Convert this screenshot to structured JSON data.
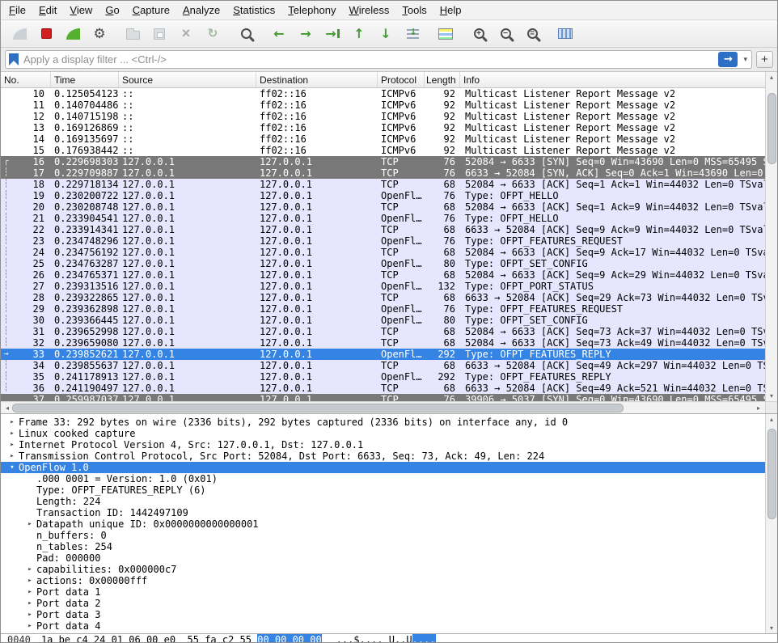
{
  "menu": {
    "items": [
      "File",
      "Edit",
      "View",
      "Go",
      "Capture",
      "Analyze",
      "Statistics",
      "Telephony",
      "Wireless",
      "Tools",
      "Help"
    ]
  },
  "toolbar": {
    "groups": [
      [
        {
          "name": "start-capture",
          "icon": "fin-start",
          "disabled": true
        },
        {
          "name": "stop-capture",
          "icon": "stop",
          "disabled": false
        },
        {
          "name": "restart-capture",
          "icon": "fin-restart",
          "disabled": false
        },
        {
          "name": "capture-options",
          "icon": "gear",
          "disabled": false
        }
      ],
      [
        {
          "name": "open-capture-file",
          "icon": "folder",
          "disabled": true
        },
        {
          "name": "save-capture-file",
          "icon": "save",
          "disabled": true
        },
        {
          "name": "close-capture-file",
          "icon": "close",
          "disabled": true
        },
        {
          "name": "reload-capture-file",
          "icon": "reload",
          "disabled": true
        }
      ],
      [
        {
          "name": "find-packet",
          "icon": "find",
          "disabled": false
        }
      ],
      [
        {
          "name": "go-back",
          "icon": "arrow-left",
          "disabled": false
        },
        {
          "name": "go-forward",
          "icon": "arrow-right",
          "disabled": false
        },
        {
          "name": "go-to-packet",
          "icon": "goto",
          "disabled": false
        },
        {
          "name": "go-first-packet",
          "icon": "arrow-up",
          "disabled": false
        },
        {
          "name": "go-last-packet",
          "icon": "arrow-down",
          "disabled": false
        },
        {
          "name": "auto-scroll",
          "icon": "autoscroll",
          "disabled": false
        }
      ],
      [
        {
          "name": "colorize-packets",
          "icon": "colorize",
          "disabled": false
        }
      ],
      [
        {
          "name": "zoom-in",
          "icon": "zoom-in",
          "disabled": false
        },
        {
          "name": "zoom-out",
          "icon": "zoom-out",
          "disabled": false
        },
        {
          "name": "zoom-normal",
          "icon": "zoom-normal",
          "disabled": false
        }
      ],
      [
        {
          "name": "resize-columns",
          "icon": "resize-columns",
          "disabled": false
        }
      ]
    ]
  },
  "filter": {
    "placeholder": "Apply a display filter ... <Ctrl-/>",
    "add_button": "+"
  },
  "packet_list": {
    "columns": [
      "No.",
      "Time",
      "Source",
      "Destination",
      "Protocol",
      "Length",
      "Info"
    ],
    "rows": [
      {
        "no": "10",
        "time": "0.125054123",
        "src": "::",
        "dst": "ff02::16",
        "proto": "ICMPv6",
        "len": "92",
        "info": "Multicast Listener Report Message v2",
        "style": "white",
        "mark": ""
      },
      {
        "no": "11",
        "time": "0.140704486",
        "src": "::",
        "dst": "ff02::16",
        "proto": "ICMPv6",
        "len": "92",
        "info": "Multicast Listener Report Message v2",
        "style": "white",
        "mark": ""
      },
      {
        "no": "12",
        "time": "0.140715198",
        "src": "::",
        "dst": "ff02::16",
        "proto": "ICMPv6",
        "len": "92",
        "info": "Multicast Listener Report Message v2",
        "style": "white",
        "mark": ""
      },
      {
        "no": "13",
        "time": "0.169126869",
        "src": "::",
        "dst": "ff02::16",
        "proto": "ICMPv6",
        "len": "92",
        "info": "Multicast Listener Report Message v2",
        "style": "white",
        "mark": ""
      },
      {
        "no": "14",
        "time": "0.169135697",
        "src": "::",
        "dst": "ff02::16",
        "proto": "ICMPv6",
        "len": "92",
        "info": "Multicast Listener Report Message v2",
        "style": "white",
        "mark": ""
      },
      {
        "no": "15",
        "time": "0.176938442",
        "src": "::",
        "dst": "ff02::16",
        "proto": "ICMPv6",
        "len": "92",
        "info": "Multicast Listener Report Message v2",
        "style": "white",
        "mark": ""
      },
      {
        "no": "16",
        "time": "0.229698303",
        "src": "127.0.0.1",
        "dst": "127.0.0.1",
        "proto": "TCP",
        "len": "76",
        "info": "52084 → 6633 [SYN] Seq=0 Win=43690 Len=0 MSS=65495 S",
        "style": "gray",
        "mark": "┌"
      },
      {
        "no": "17",
        "time": "0.229709887",
        "src": "127.0.0.1",
        "dst": "127.0.0.1",
        "proto": "TCP",
        "len": "76",
        "info": "6633 → 52084 [SYN, ACK] Seq=0 Ack=1 Win=43690 Len=0",
        "style": "gray",
        "mark": "┆"
      },
      {
        "no": "18",
        "time": "0.229718134",
        "src": "127.0.0.1",
        "dst": "127.0.0.1",
        "proto": "TCP",
        "len": "68",
        "info": "52084 → 6633 [ACK] Seq=1 Ack=1 Win=44032 Len=0 TSval",
        "style": "tcp",
        "mark": "┆"
      },
      {
        "no": "19",
        "time": "0.230200722",
        "src": "127.0.0.1",
        "dst": "127.0.0.1",
        "proto": "OpenFl…",
        "len": "76",
        "info": "Type: OFPT_HELLO",
        "style": "tcp",
        "mark": "┆"
      },
      {
        "no": "20",
        "time": "0.230208748",
        "src": "127.0.0.1",
        "dst": "127.0.0.1",
        "proto": "TCP",
        "len": "68",
        "info": "52084 → 6633 [ACK] Seq=1 Ack=9 Win=44032 Len=0 TSval",
        "style": "tcp",
        "mark": "┆"
      },
      {
        "no": "21",
        "time": "0.233904541",
        "src": "127.0.0.1",
        "dst": "127.0.0.1",
        "proto": "OpenFl…",
        "len": "76",
        "info": "Type: OFPT_HELLO",
        "style": "tcp",
        "mark": "┆"
      },
      {
        "no": "22",
        "time": "0.233914341",
        "src": "127.0.0.1",
        "dst": "127.0.0.1",
        "proto": "TCP",
        "len": "68",
        "info": "6633 → 52084 [ACK] Seq=9 Ack=9 Win=44032 Len=0 TSval",
        "style": "tcp",
        "mark": "┆"
      },
      {
        "no": "23",
        "time": "0.234748296",
        "src": "127.0.0.1",
        "dst": "127.0.0.1",
        "proto": "OpenFl…",
        "len": "76",
        "info": "Type: OFPT_FEATURES_REQUEST",
        "style": "tcp",
        "mark": "┆"
      },
      {
        "no": "24",
        "time": "0.234756192",
        "src": "127.0.0.1",
        "dst": "127.0.0.1",
        "proto": "TCP",
        "len": "68",
        "info": "52084 → 6633 [ACK] Seq=9 Ack=17 Win=44032 Len=0 TSva",
        "style": "tcp",
        "mark": "┆"
      },
      {
        "no": "25",
        "time": "0.234763287",
        "src": "127.0.0.1",
        "dst": "127.0.0.1",
        "proto": "OpenFl…",
        "len": "80",
        "info": "Type: OFPT_SET_CONFIG",
        "style": "tcp",
        "mark": "┆"
      },
      {
        "no": "26",
        "time": "0.234765371",
        "src": "127.0.0.1",
        "dst": "127.0.0.1",
        "proto": "TCP",
        "len": "68",
        "info": "52084 → 6633 [ACK] Seq=9 Ack=29 Win=44032 Len=0 TSva",
        "style": "tcp",
        "mark": "┆"
      },
      {
        "no": "27",
        "time": "0.239313516",
        "src": "127.0.0.1",
        "dst": "127.0.0.1",
        "proto": "OpenFl…",
        "len": "132",
        "info": "Type: OFPT_PORT_STATUS",
        "style": "tcp",
        "mark": "┆"
      },
      {
        "no": "28",
        "time": "0.239322865",
        "src": "127.0.0.1",
        "dst": "127.0.0.1",
        "proto": "TCP",
        "len": "68",
        "info": "6633 → 52084 [ACK] Seq=29 Ack=73 Win=44032 Len=0 TSv",
        "style": "tcp",
        "mark": "┆"
      },
      {
        "no": "29",
        "time": "0.239362898",
        "src": "127.0.0.1",
        "dst": "127.0.0.1",
        "proto": "OpenFl…",
        "len": "76",
        "info": "Type: OFPT_FEATURES_REQUEST",
        "style": "tcp",
        "mark": "┆"
      },
      {
        "no": "30",
        "time": "0.239366445",
        "src": "127.0.0.1",
        "dst": "127.0.0.1",
        "proto": "OpenFl…",
        "len": "80",
        "info": "Type: OFPT_SET_CONFIG",
        "style": "tcp",
        "mark": "┆"
      },
      {
        "no": "31",
        "time": "0.239652998",
        "src": "127.0.0.1",
        "dst": "127.0.0.1",
        "proto": "TCP",
        "len": "68",
        "info": "52084 → 6633 [ACK] Seq=73 Ack=37 Win=44032 Len=0 TSv",
        "style": "tcp",
        "mark": "┆"
      },
      {
        "no": "32",
        "time": "0.239659080",
        "src": "127.0.0.1",
        "dst": "127.0.0.1",
        "proto": "TCP",
        "len": "68",
        "info": "52084 → 6633 [ACK] Seq=73 Ack=49 Win=44032 Len=0 TSv",
        "style": "tcp",
        "mark": "┆"
      },
      {
        "no": "33",
        "time": "0.239852621",
        "src": "127.0.0.1",
        "dst": "127.0.0.1",
        "proto": "OpenFl…",
        "len": "292",
        "info": "Type: OFPT_FEATURES_REPLY",
        "style": "selected",
        "mark": "→"
      },
      {
        "no": "34",
        "time": "0.239855637",
        "src": "127.0.0.1",
        "dst": "127.0.0.1",
        "proto": "TCP",
        "len": "68",
        "info": "6633 → 52084 [ACK] Seq=49 Ack=297 Win=44032 Len=0 TS",
        "style": "tcp",
        "mark": "┆"
      },
      {
        "no": "35",
        "time": "0.241178913",
        "src": "127.0.0.1",
        "dst": "127.0.0.1",
        "proto": "OpenFl…",
        "len": "292",
        "info": "Type: OFPT_FEATURES_REPLY",
        "style": "tcp",
        "mark": "┆"
      },
      {
        "no": "36",
        "time": "0.241190497",
        "src": "127.0.0.1",
        "dst": "127.0.0.1",
        "proto": "TCP",
        "len": "68",
        "info": "6633 → 52084 [ACK] Seq=49 Ack=521 Win=44032 Len=0 TS",
        "style": "tcp",
        "mark": "┆"
      },
      {
        "no": "37",
        "time": "0.259987037",
        "src": "127.0.0.1",
        "dst": "127.0.0.1",
        "proto": "TCP",
        "len": "76",
        "info": "39906 → 5037 [SYN] Seq=0 Win=43690 Len=0 MSS=65495 S",
        "style": "gray",
        "mark": ""
      }
    ]
  },
  "details": {
    "rows": [
      {
        "expander": "collapsed",
        "indent": 0,
        "text": "Frame 33: 292 bytes on wire (2336 bits), 292 bytes captured (2336 bits) on interface any, id 0"
      },
      {
        "expander": "collapsed",
        "indent": 0,
        "text": "Linux cooked capture"
      },
      {
        "expander": "collapsed",
        "indent": 0,
        "text": "Internet Protocol Version 4, Src: 127.0.0.1, Dst: 127.0.0.1"
      },
      {
        "expander": "collapsed",
        "indent": 0,
        "text": "Transmission Control Protocol, Src Port: 52084, Dst Port: 6633, Seq: 73, Ack: 49, Len: 224"
      },
      {
        "expander": "expanded",
        "indent": 0,
        "text": "OpenFlow 1.0",
        "selected": true
      },
      {
        "expander": "none",
        "indent": 1,
        "text": ".000 0001 = Version: 1.0 (0x01)"
      },
      {
        "expander": "none",
        "indent": 1,
        "text": "Type: OFPT_FEATURES_REPLY (6)"
      },
      {
        "expander": "none",
        "indent": 1,
        "text": "Length: 224"
      },
      {
        "expander": "none",
        "indent": 1,
        "text": "Transaction ID: 1442497109"
      },
      {
        "expander": "collapsed",
        "indent": 1,
        "text": "Datapath unique ID: 0x0000000000000001"
      },
      {
        "expander": "none",
        "indent": 1,
        "text": "n_buffers: 0"
      },
      {
        "expander": "none",
        "indent": 1,
        "text": "n_tables: 254"
      },
      {
        "expander": "none",
        "indent": 1,
        "text": "Pad: 000000"
      },
      {
        "expander": "collapsed",
        "indent": 1,
        "text": "capabilities: 0x000000c7"
      },
      {
        "expander": "collapsed",
        "indent": 1,
        "text": "actions: 0x00000fff"
      },
      {
        "expander": "collapsed",
        "indent": 1,
        "text": "Port data 1"
      },
      {
        "expander": "collapsed",
        "indent": 1,
        "text": "Port data 2"
      },
      {
        "expander": "collapsed",
        "indent": 1,
        "text": "Port data 3"
      },
      {
        "expander": "collapsed",
        "indent": 1,
        "text": "Port data 4"
      }
    ]
  },
  "bytes": {
    "offset": "0040",
    "hex": "1a be c4 24 01 06 00 e0  55 fa c2 55 ",
    "hex_selected": "00 00 00 00",
    "ascii": "...$.... U..U",
    "ascii_selected": "...."
  },
  "colors": {
    "selection": "#3584e4",
    "tcp_row": "#e7e6ff",
    "syn_fin_row": "#787878",
    "accent_blue": "#2c6fc4",
    "arrow_green": "#3f9a2f"
  }
}
